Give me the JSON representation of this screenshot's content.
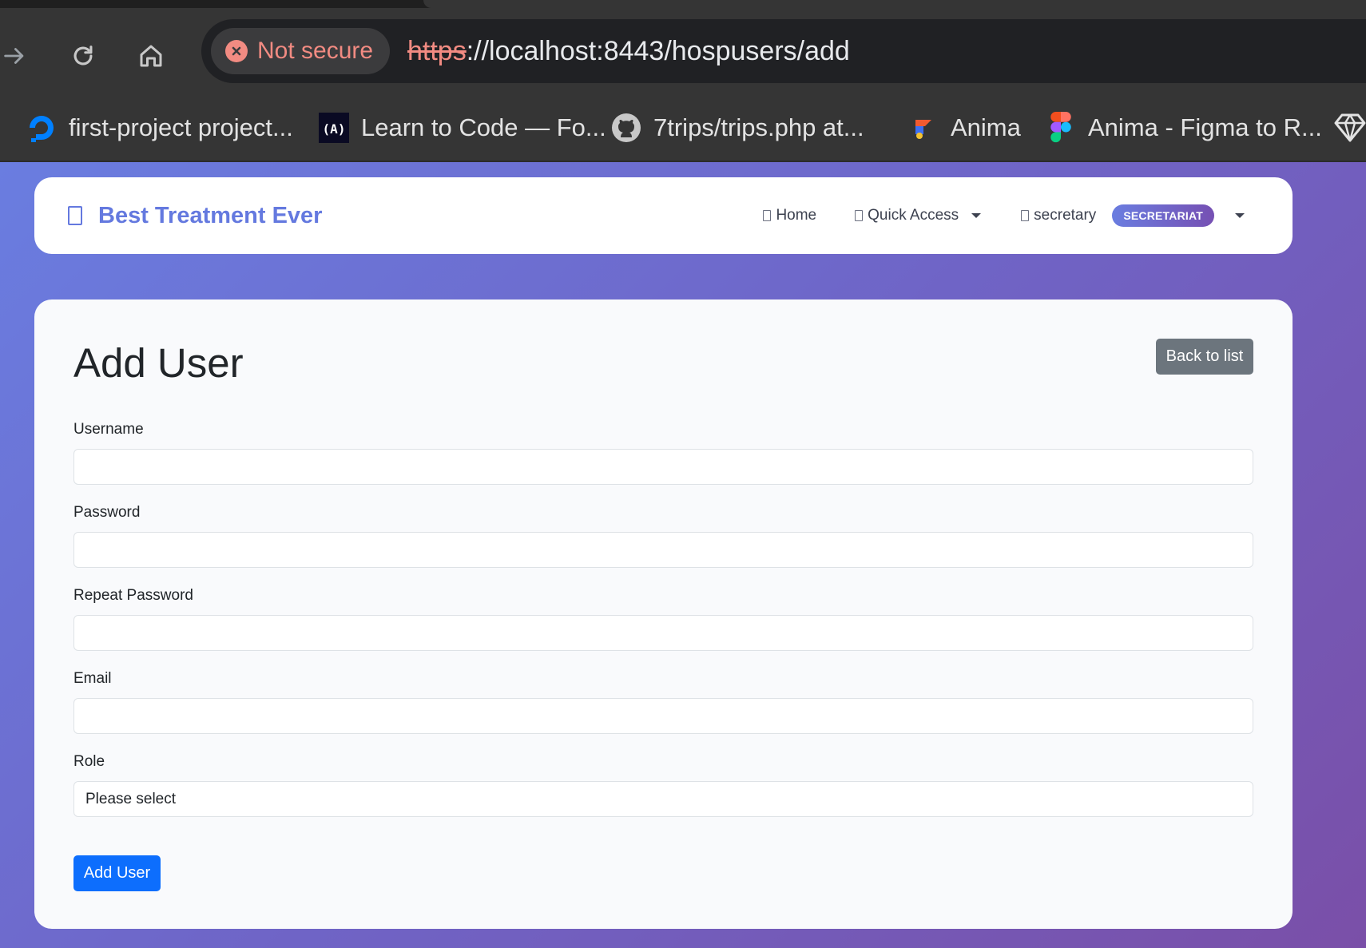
{
  "browser": {
    "security_label": "Not secure",
    "url_scheme": "https",
    "url_rest": "://localhost:8443/hospusers/add",
    "bookmarks": [
      {
        "label": "first-project project...",
        "icon": "digitalocean-icon"
      },
      {
        "label": "Learn to Code — Fo...",
        "icon": "freecodecamp-icon"
      },
      {
        "label": "7trips/trips.php at...",
        "icon": "github-icon"
      },
      {
        "label": "Anima",
        "icon": "anima-icon"
      },
      {
        "label": "Anima - Figma to R...",
        "icon": "figma-icon"
      },
      {
        "label": "",
        "icon": "sketch-icon"
      }
    ]
  },
  "navbar": {
    "brand": "Best Treatment Ever",
    "home": "Home",
    "quick_access": "Quick Access",
    "username": "secretary",
    "role_badge": "SECRETARIAT"
  },
  "form": {
    "title": "Add User",
    "back_label": "Back to list",
    "fields": {
      "username": {
        "label": "Username",
        "value": ""
      },
      "password": {
        "label": "Password",
        "value": ""
      },
      "repeat_password": {
        "label": "Repeat Password",
        "value": ""
      },
      "email": {
        "label": "Email",
        "value": ""
      },
      "role": {
        "label": "Role",
        "selected": "Please select"
      }
    },
    "submit_label": "Add User"
  },
  "colors": {
    "brand": "#6479df",
    "primary": "#0d6efd",
    "secondary": "#6c757d",
    "insecure": "#f28b82"
  }
}
